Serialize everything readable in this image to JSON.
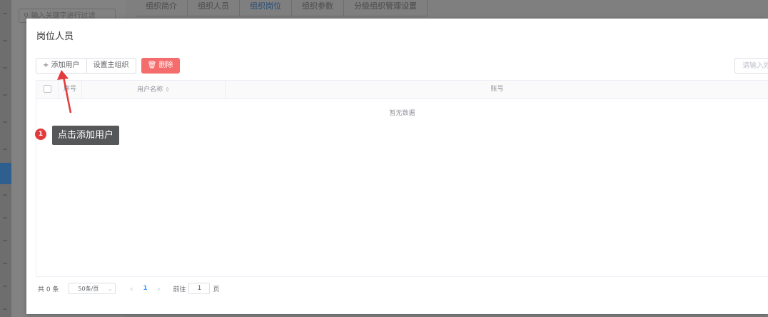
{
  "background": {
    "search_placeholder": "输入关键字进行过滤",
    "tabs": [
      {
        "label": "组织简介"
      },
      {
        "label": "组织人员"
      },
      {
        "label": "组织岗位"
      },
      {
        "label": "组织参数"
      },
      {
        "label": "分级组织管理设置"
      }
    ],
    "active_tab_index": 2
  },
  "dialog": {
    "title": "岗位人员",
    "toolbar": {
      "add_user_label": "+ 添加用户",
      "set_main_org_label": "设置主组织",
      "delete_label": "删除"
    },
    "search": {
      "placeholder": "请输入姓名"
    },
    "table": {
      "columns": [
        "序号",
        "用户名称",
        "账号"
      ],
      "sort_icon": "sort-caret-icon",
      "empty_text": "暂无数据"
    },
    "pagination": {
      "total_text": "共 0 条",
      "page_size_label": "50条/页",
      "current_page": "1",
      "goto_label": "前往",
      "goto_value": "1",
      "goto_unit": "页"
    }
  },
  "annotation": {
    "step_number": "1",
    "tooltip_text": "点击添加用户",
    "accent_color": "#e23b3b"
  },
  "colors": {
    "primary": "#409eff",
    "danger": "#f56c6c",
    "overlay": "#7f7f7f"
  }
}
